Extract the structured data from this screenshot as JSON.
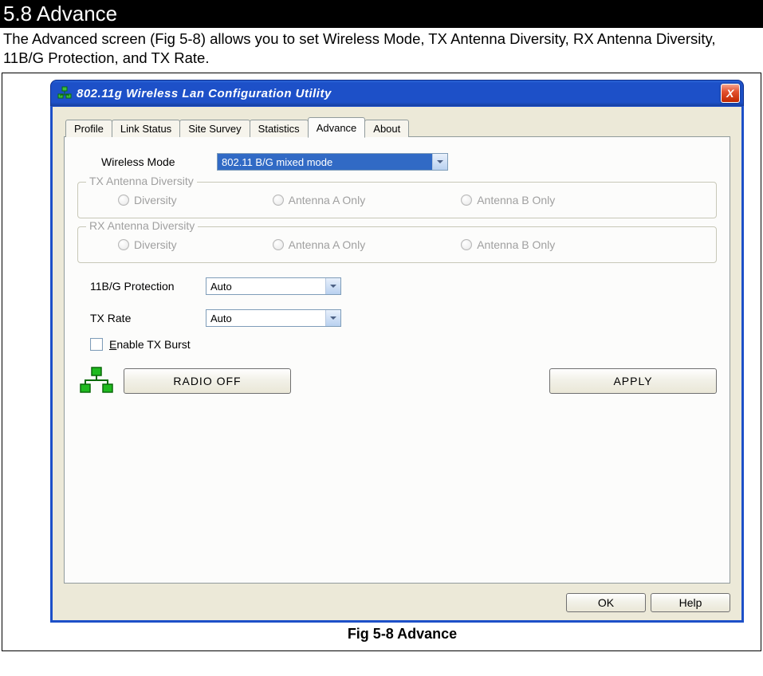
{
  "section": {
    "heading": "5.8 Advance",
    "description": "The Advanced screen (Fig 5-8) allows you to set Wireless Mode, TX Antenna Diversity, RX Antenna Diversity, 11B/G Protection, and TX Rate.",
    "caption": "Fig 5-8 Advance"
  },
  "window": {
    "title": "802.11g Wireless Lan Configuration Utility",
    "close_glyph": "X",
    "tabs": [
      {
        "label": "Profile"
      },
      {
        "label": "Link Status"
      },
      {
        "label": "Site Survey"
      },
      {
        "label": "Statistics"
      },
      {
        "label": "Advance",
        "active": true
      },
      {
        "label": "About"
      }
    ],
    "advance_tab": {
      "wireless_mode_label": "Wireless Mode",
      "wireless_mode_value": "802.11 B/G mixed mode",
      "tx_group": {
        "legend": "TX Antenna Diversity",
        "options": [
          "Diversity",
          "Antenna A Only",
          "Antenna B Only"
        ],
        "enabled": false
      },
      "rx_group": {
        "legend": "RX Antenna Diversity",
        "options": [
          "Diversity",
          "Antenna A Only",
          "Antenna B Only"
        ],
        "enabled": false
      },
      "protection_label": "11B/G Protection",
      "protection_value": "Auto",
      "txrate_label": "TX Rate",
      "txrate_value": "Auto",
      "checkbox_label": "Enable TX Burst",
      "checkbox_checked": false,
      "radio_off_label": "RADIO OFF",
      "apply_label": "APPLY"
    },
    "footer": {
      "ok_label": "OK",
      "help_label": "Help"
    }
  }
}
